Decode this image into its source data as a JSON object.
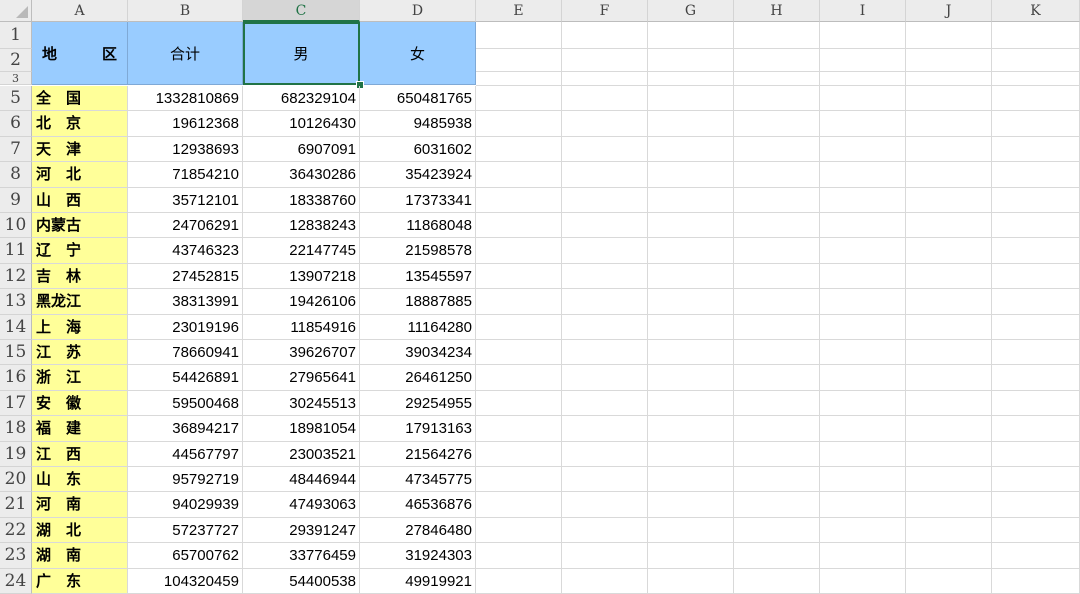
{
  "columns": [
    "A",
    "B",
    "C",
    "D",
    "E",
    "F",
    "G",
    "H",
    "I",
    "J",
    "K"
  ],
  "selected_column": "C",
  "header_rows_label": [
    "1",
    "2",
    "3"
  ],
  "header": {
    "region_left": "地",
    "region_right": "区",
    "total": "合计",
    "male": "男",
    "female": "女"
  },
  "rows": [
    {
      "row": "5",
      "region": "全　国",
      "total": "1332810869",
      "male": "682329104",
      "female": "650481765"
    },
    {
      "row": "6",
      "region": "北　京",
      "total": "19612368",
      "male": "10126430",
      "female": "9485938"
    },
    {
      "row": "7",
      "region": "天　津",
      "total": "12938693",
      "male": "6907091",
      "female": "6031602"
    },
    {
      "row": "8",
      "region": "河　北",
      "total": "71854210",
      "male": "36430286",
      "female": "35423924"
    },
    {
      "row": "9",
      "region": "山　西",
      "total": "35712101",
      "male": "18338760",
      "female": "17373341"
    },
    {
      "row": "10",
      "region": "内蒙古",
      "total": "24706291",
      "male": "12838243",
      "female": "11868048"
    },
    {
      "row": "11",
      "region": "辽　宁",
      "total": "43746323",
      "male": "22147745",
      "female": "21598578"
    },
    {
      "row": "12",
      "region": "吉　林",
      "total": "27452815",
      "male": "13907218",
      "female": "13545597"
    },
    {
      "row": "13",
      "region": "黑龙江",
      "total": "38313991",
      "male": "19426106",
      "female": "18887885"
    },
    {
      "row": "14",
      "region": "上　海",
      "total": "23019196",
      "male": "11854916",
      "female": "11164280"
    },
    {
      "row": "15",
      "region": "江　苏",
      "total": "78660941",
      "male": "39626707",
      "female": "39034234"
    },
    {
      "row": "16",
      "region": "浙　江",
      "total": "54426891",
      "male": "27965641",
      "female": "26461250"
    },
    {
      "row": "17",
      "region": "安　徽",
      "total": "59500468",
      "male": "30245513",
      "female": "29254955"
    },
    {
      "row": "18",
      "region": "福　建",
      "total": "36894217",
      "male": "18981054",
      "female": "17913163"
    },
    {
      "row": "19",
      "region": "江　西",
      "total": "44567797",
      "male": "23003521",
      "female": "21564276"
    },
    {
      "row": "20",
      "region": "山　东",
      "total": "95792719",
      "male": "48446944",
      "female": "47345775"
    },
    {
      "row": "21",
      "region": "河　南",
      "total": "94029939",
      "male": "47493063",
      "female": "46536876"
    },
    {
      "row": "22",
      "region": "湖　北",
      "total": "57237727",
      "male": "29391247",
      "female": "27846480"
    },
    {
      "row": "23",
      "region": "湖　南",
      "total": "65700762",
      "male": "33776459",
      "female": "31924303"
    },
    {
      "row": "24",
      "region": "广　东",
      "total": "104320459",
      "male": "54400538",
      "female": "49919921"
    }
  ],
  "colors": {
    "header_fill": "#99ccff",
    "region_fill": "#ffff99",
    "selection": "#217346"
  }
}
